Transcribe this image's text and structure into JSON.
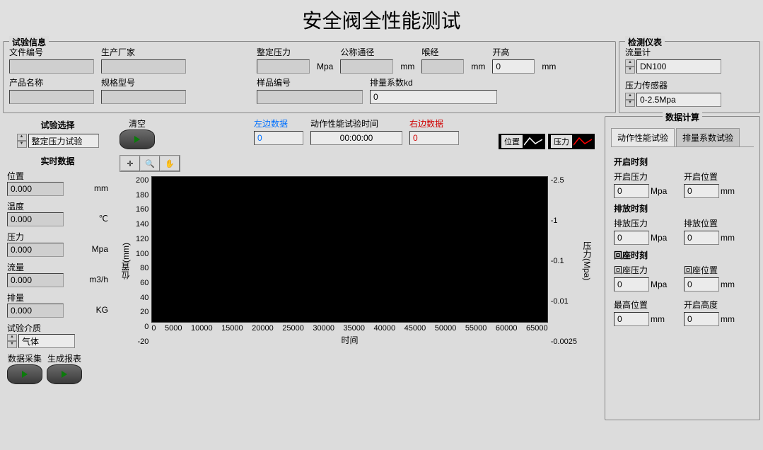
{
  "title": "安全阀全性能测试",
  "test_info": {
    "legend": "试验信息",
    "fields": {
      "file_no_label": "文件编号",
      "file_no": "",
      "manufacturer_label": "生产厂家",
      "manufacturer": "",
      "product_name_label": "产品名称",
      "product_name": "",
      "model_label": "规格型号",
      "model": "",
      "set_pressure_label": "整定压力",
      "set_pressure": "",
      "set_pressure_unit": "Mpa",
      "nominal_diameter_label": "公称通径",
      "nominal_diameter": "",
      "nominal_diameter_unit": "mm",
      "throat_label": "喉经",
      "throat": "",
      "throat_unit": "mm",
      "lift_label": "开高",
      "lift": "0",
      "lift_unit": "mm",
      "sample_no_label": "样品编号",
      "sample_no": "",
      "discharge_coef_label": "排量系数kd",
      "discharge_coef": "0"
    }
  },
  "instruments": {
    "legend": "检测仪表",
    "flowmeter_label": "流量计",
    "flowmeter": "DN100",
    "pressure_sensor_label": "压力传感器",
    "pressure_sensor": "0-2.5Mpa"
  },
  "test_select": {
    "label": "试验选择",
    "value": "整定压力试验"
  },
  "clear_label": "清空",
  "left_data": {
    "label": "左边数据",
    "value": "0",
    "color": "#0070ff"
  },
  "timer": {
    "label": "动作性能试验时间",
    "value": "00:00:00"
  },
  "right_data": {
    "label": "右边数据",
    "value": "0",
    "color": "#d00000"
  },
  "realtime": {
    "legend": "实时数据",
    "position_label": "位置",
    "position": "0.000",
    "position_unit": "mm",
    "temp_label": "温度",
    "temp": "0.000",
    "temp_unit": "℃",
    "pressure_label": "压力",
    "pressure": "0.000",
    "pressure_unit": "Mpa",
    "flow_label": "流量",
    "flow": "0.000",
    "flow_unit": "m3/h",
    "discharge_label": "排量",
    "discharge": "0.000",
    "discharge_unit": "KG",
    "medium_label": "试验介质",
    "medium": "气体"
  },
  "data_collect_label": "数据采集",
  "gen_report_label": "生成报表",
  "chart_legend": {
    "position": "位置",
    "pressure": "压力"
  },
  "chart_data": {
    "type": "line",
    "title": "",
    "xlabel": "时间",
    "x": [
      0,
      5000,
      10000,
      15000,
      20000,
      25000,
      30000,
      35000,
      40000,
      45000,
      50000,
      55000,
      60000,
      65000
    ],
    "series": [
      {
        "name": "位置(mm)",
        "axis": "left",
        "values": []
      },
      {
        "name": "压力(Mpa)",
        "axis": "right",
        "values": []
      }
    ],
    "y_left_label": "位置(mm)",
    "y_left_ticks": [
      200,
      180,
      160,
      140,
      120,
      100,
      80,
      60,
      40,
      20,
      0,
      -20
    ],
    "y_right_label": "压力(Mpa)",
    "y_right_ticks": [
      -2.5,
      -1,
      -0.1,
      -0.01,
      -0.0025
    ],
    "xlim": [
      0,
      65000
    ]
  },
  "calc": {
    "legend": "数据计算",
    "tabs": [
      "动作性能试验",
      "排量系数试验"
    ],
    "active_tab": 0,
    "open_heading": "开启时刻",
    "open_pressure_label": "开启压力",
    "open_pressure": "0",
    "mpa": "Mpa",
    "open_position_label": "开启位置",
    "open_position": "0",
    "mm": "mm",
    "discharge_heading": "排放时刻",
    "discharge_pressure_label": "排放压力",
    "discharge_pressure": "0",
    "discharge_position_label": "排放位置",
    "discharge_position": "0",
    "reseat_heading": "回座时刻",
    "reseat_pressure_label": "回座压力",
    "reseat_pressure": "0",
    "reseat_position_label": "回座位置",
    "reseat_position": "0",
    "max_position_label": "最高位置",
    "max_position": "0",
    "lift_height_label": "开启高度",
    "lift_height": "0"
  }
}
